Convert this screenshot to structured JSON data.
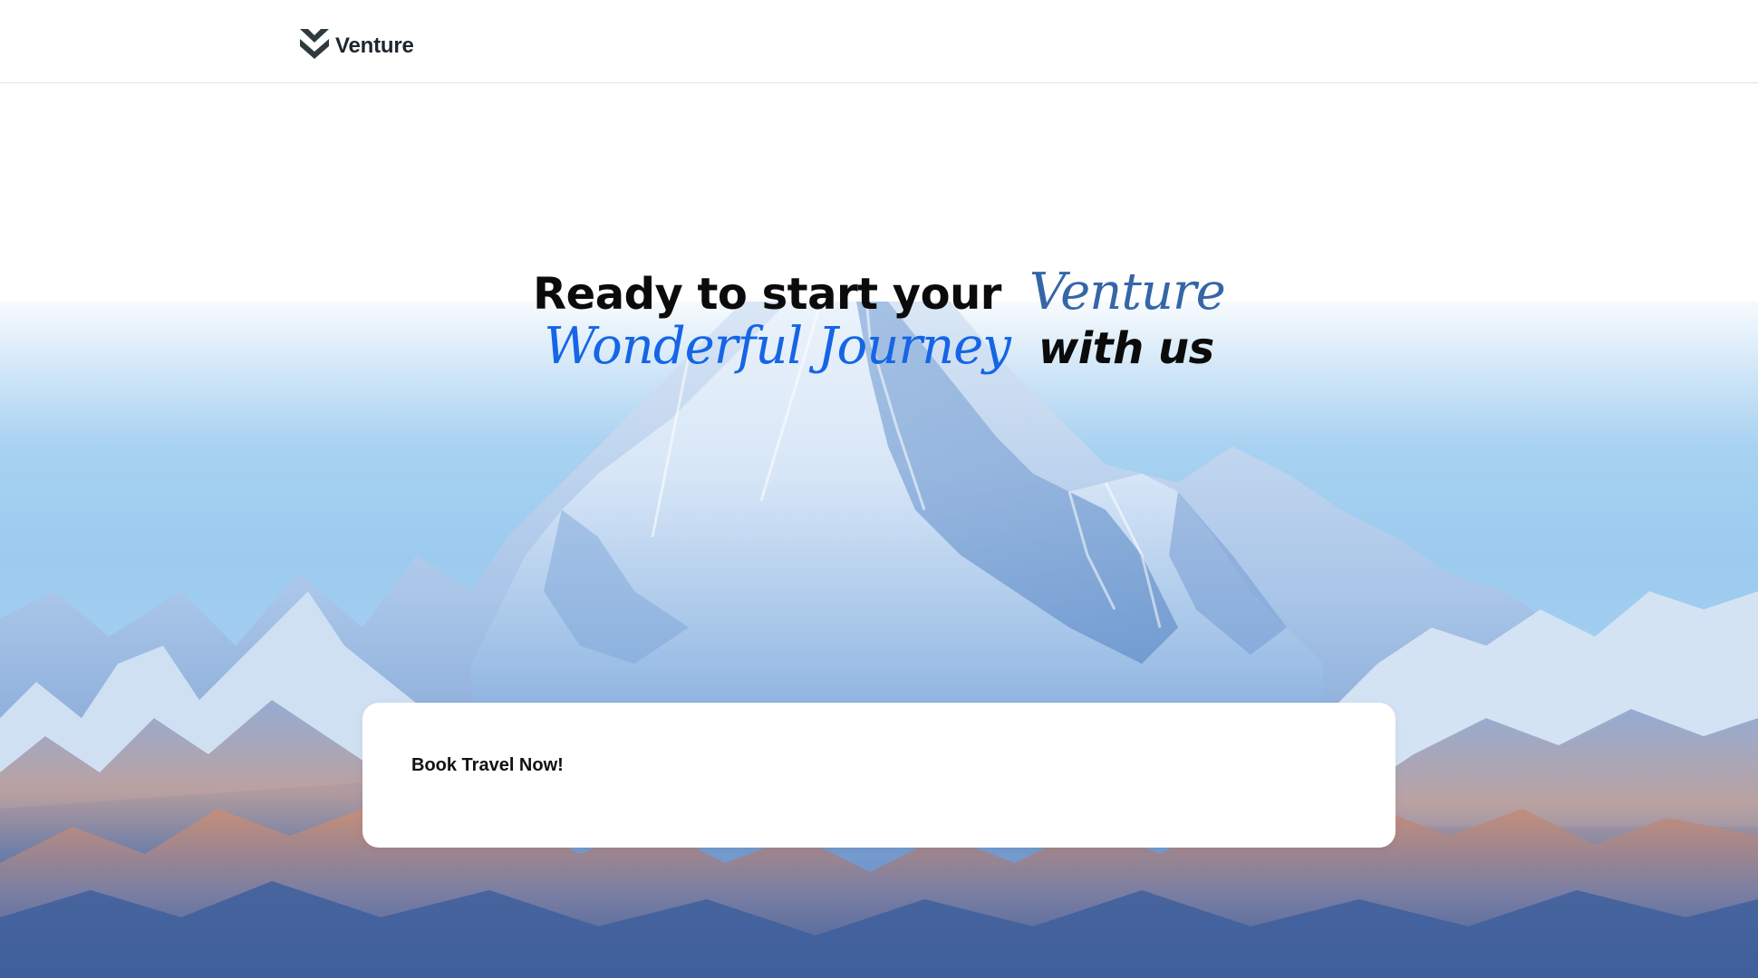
{
  "header": {
    "brand_name": "Venture",
    "logo_icon": "venture-chevron-logo-icon"
  },
  "hero": {
    "line1_text": "Ready to start your",
    "line1_accent": "Venture",
    "line2_accent": "Wonderful Journey",
    "line2_text": "with us",
    "background": "snowy-mountain-range-photo"
  },
  "booking": {
    "title": "Book Travel Now!"
  },
  "colors": {
    "accent_dark_blue": "#3566a8",
    "accent_bright_blue": "#1565e6",
    "text_dark": "#0b0b0b",
    "logo_dark": "#2d3a40"
  }
}
